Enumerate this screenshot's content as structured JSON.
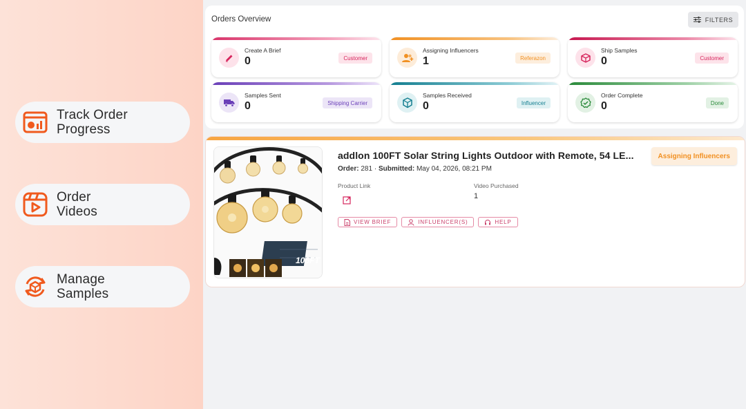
{
  "features": [
    {
      "label": "Track Order\nProgress",
      "icon": "chart-window-icon"
    },
    {
      "label": "Order\nVideos",
      "icon": "video-play-icon"
    },
    {
      "label": "Manage\nSamples",
      "icon": "refresh-box-icon"
    }
  ],
  "overview": {
    "title": "Orders Overview",
    "filters_label": "FILTERS",
    "stats": [
      {
        "label": "Create A Brief",
        "value": "0",
        "badge": "Customer",
        "icon": "pencil-icon",
        "accent": "#e0467c"
      },
      {
        "label": "Assigning Influencers",
        "value": "1",
        "badge": "Referazon",
        "icon": "group-add-icon",
        "accent": "#f29a2e"
      },
      {
        "label": "Ship Samples",
        "value": "0",
        "badge": "Customer",
        "icon": "box-icon",
        "accent": "#d6245c"
      },
      {
        "label": "Samples Sent",
        "value": "0",
        "badge": "Shipping Carrier",
        "icon": "truck-icon",
        "accent": "#7a4bc2"
      },
      {
        "label": "Samples Received",
        "value": "0",
        "badge": "Influencer",
        "icon": "package-open-icon",
        "accent": "#1b8a9e"
      },
      {
        "label": "Order Complete",
        "value": "0",
        "badge": "Done",
        "icon": "check-badge-icon",
        "accent": "#2e8b3e"
      }
    ]
  },
  "order": {
    "title": "addlon 100FT Solar String Lights Outdoor with Remote, 54 LE...",
    "order_label": "Order:",
    "order_no": "281",
    "separator": "·",
    "submitted_label": "Submitted:",
    "submitted_value": "May 04, 2026, 08:21 PM",
    "status": "Assigning Influencers",
    "product_link_label": "Product Link",
    "video_label": "Video Purchased",
    "video_value": "1",
    "image_badge": "106FT",
    "actions": {
      "view_brief": "VIEW BRIEF",
      "influencers": "INFLUENCER(S)",
      "help": "HELP"
    }
  }
}
